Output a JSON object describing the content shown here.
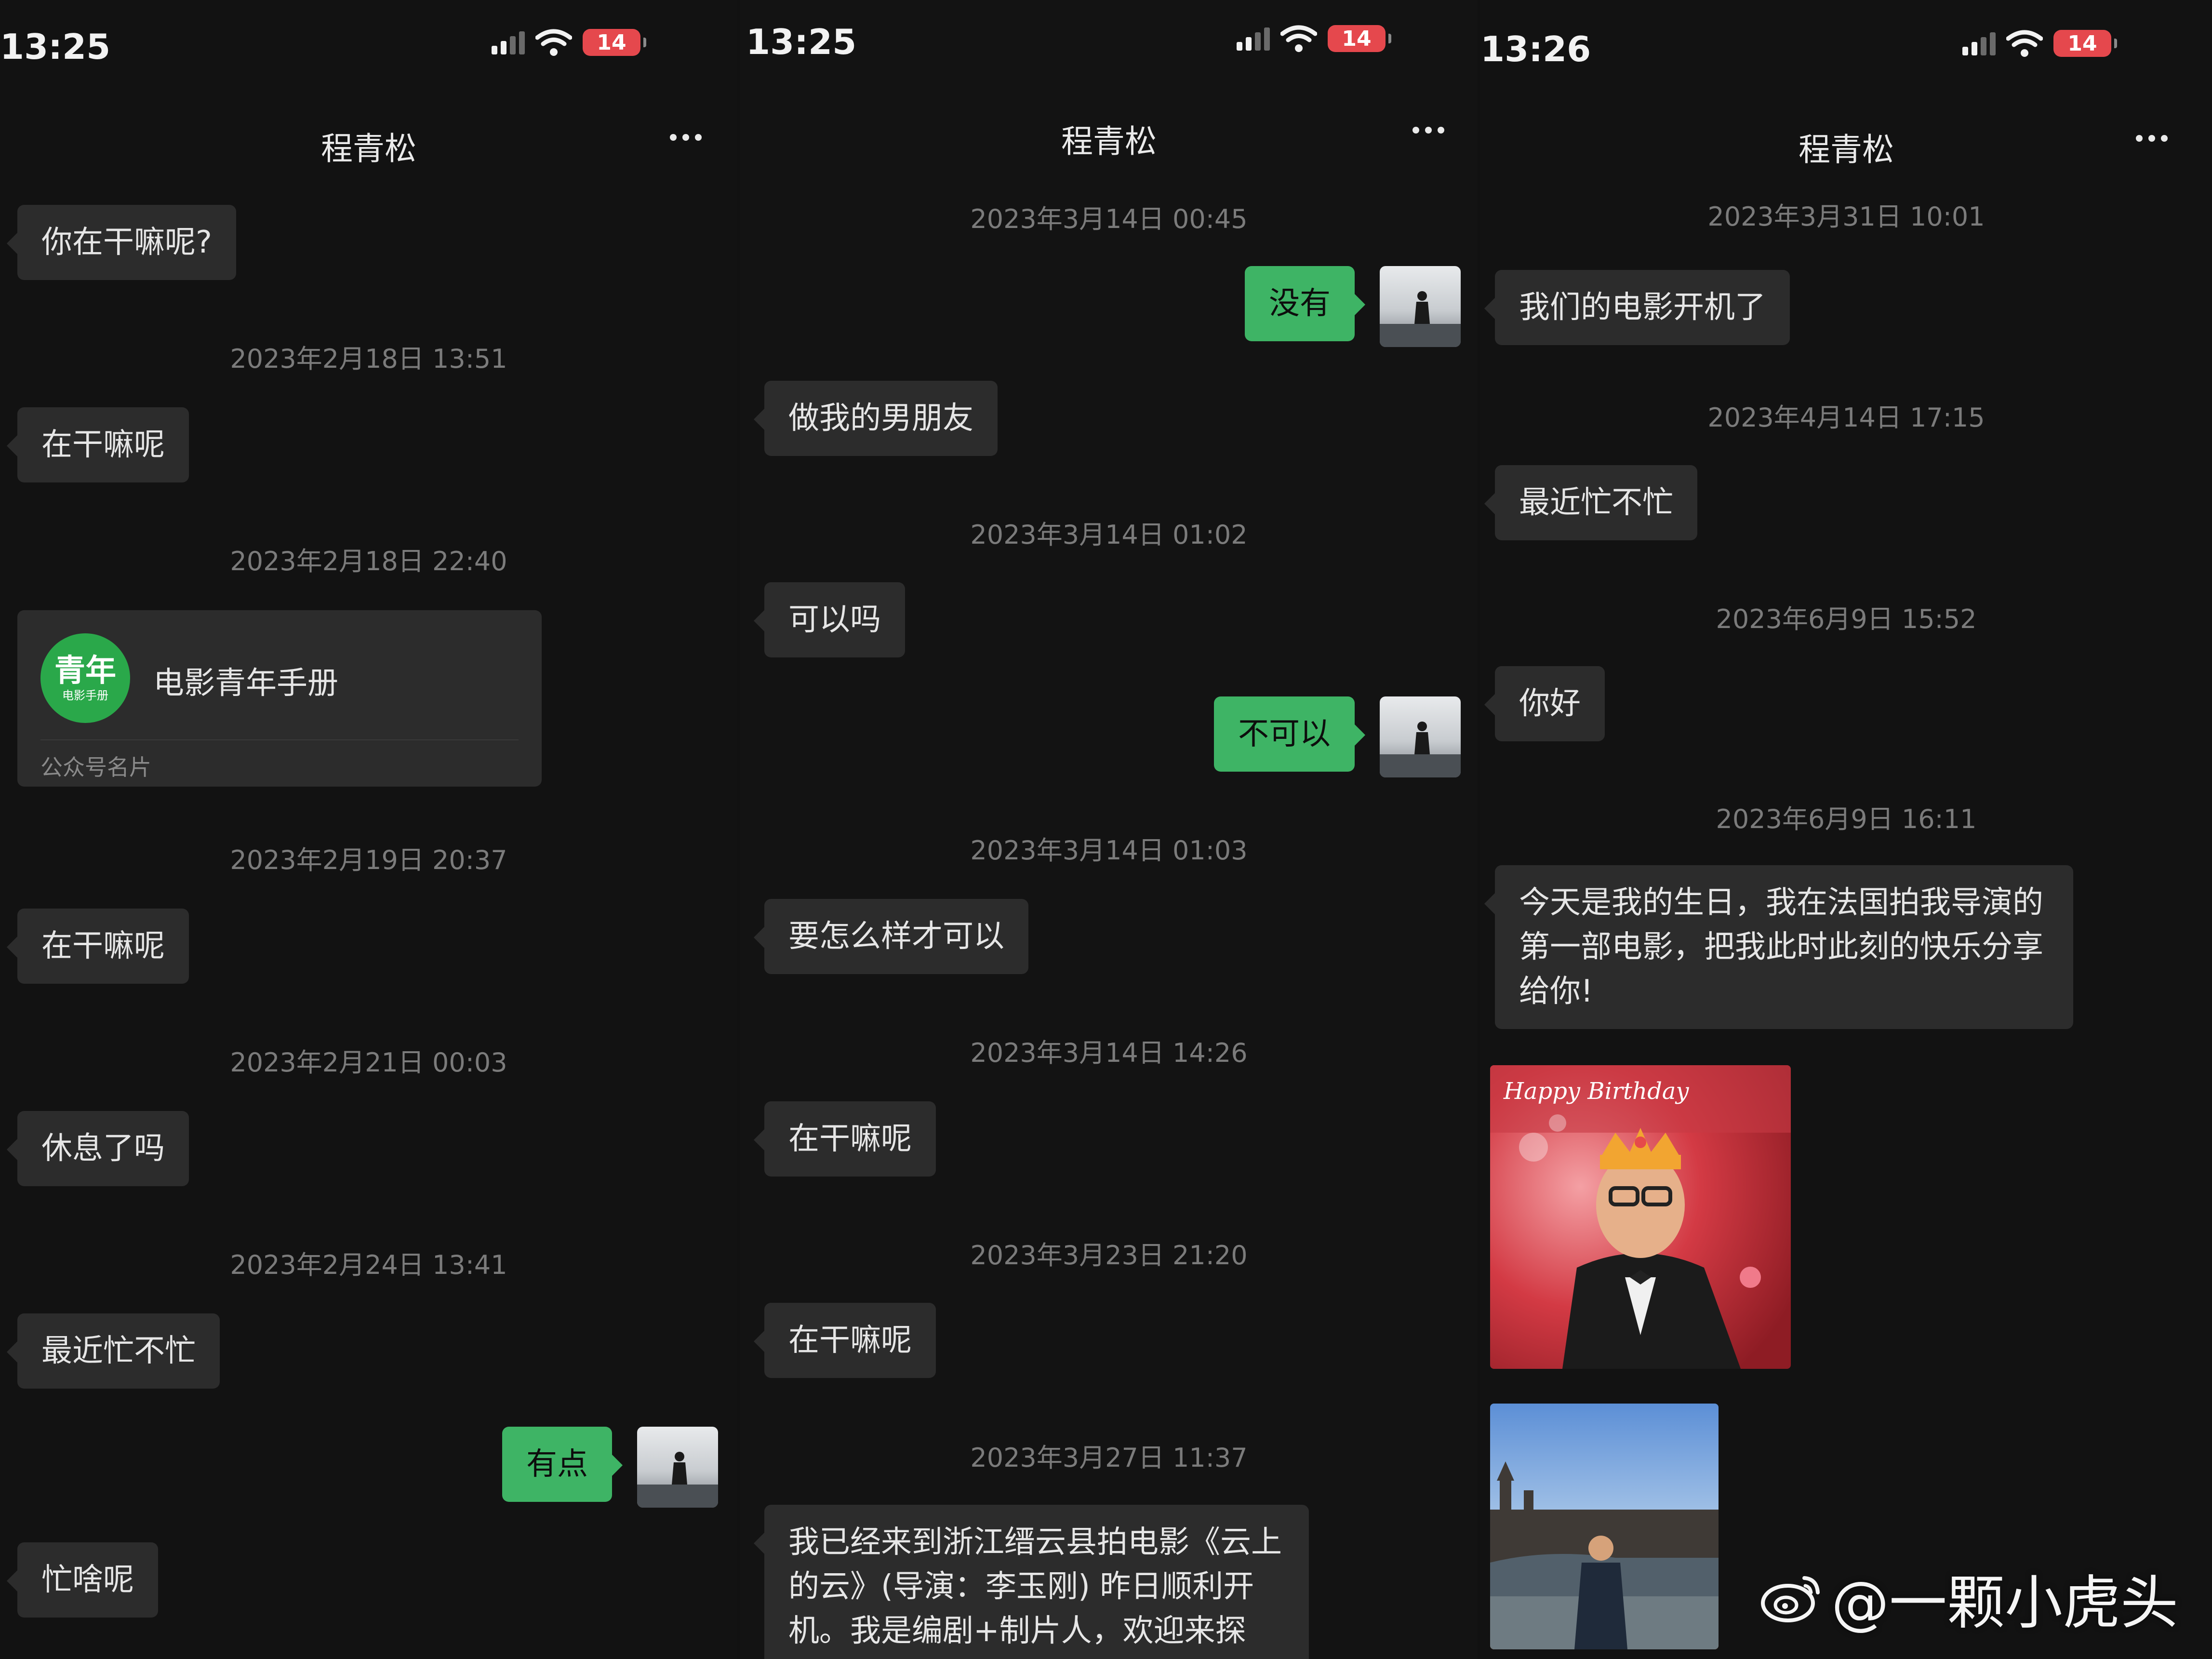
{
  "chat_title": "程青松",
  "battery_level": "14",
  "watermark": "@一颗小虎头",
  "panels": [
    {
      "status_time": "13:25",
      "messages": {
        "m0": "你在干嘛呢?",
        "t1": "2023年2月18日 13:51",
        "m1": "在干嘛呢",
        "t2": "2023年2月18日 22:40",
        "card": {
          "logo_big": "青年",
          "logo_small": "电影手册",
          "name": "电影青年手册",
          "type": "公众号名片"
        },
        "t3": "2023年2月19日 20:37",
        "m3": "在干嘛呢",
        "t4": "2023年2月21日 00:03",
        "m4": "休息了吗",
        "t5": "2023年2月24日 13:41",
        "m5": "最近忙不忙",
        "m6": "有点",
        "m7": "忙啥呢"
      }
    },
    {
      "status_time": "13:25",
      "messages": {
        "t0": "2023年3月14日 00:45",
        "m0": "没有",
        "m1": "做我的男朋友",
        "t2": "2023年3月14日 01:02",
        "m2": "可以吗",
        "m3": "不可以",
        "t4": "2023年3月14日 01:03",
        "m4": "要怎么样才可以",
        "t5": "2023年3月14日 14:26",
        "m5": "在干嘛呢",
        "t6": "2023年3月23日 21:20",
        "m6": "在干嘛呢",
        "t7": "2023年3月27日 11:37",
        "m7": "我已经来到浙江缙云县拍电影《云上的云》(导演：李玉刚) 昨日顺利开机。我是编剧+制片人，欢迎来探"
      }
    },
    {
      "status_time": "13:26",
      "messages": {
        "t0": "2023年3月31日 10:01",
        "m0": "我们的电影开机了",
        "t1": "2023年4月14日 17:15",
        "m1": "最近忙不忙",
        "t2": "2023年6月9日 15:52",
        "m2": "你好",
        "t3": "2023年6月9日 16:11",
        "m3": "今天是我的生日，我在法国拍我导演的第一部电影，把我此时此刻的快乐分享给你!",
        "photo1_caption": "Happy Birthday"
      }
    }
  ]
}
